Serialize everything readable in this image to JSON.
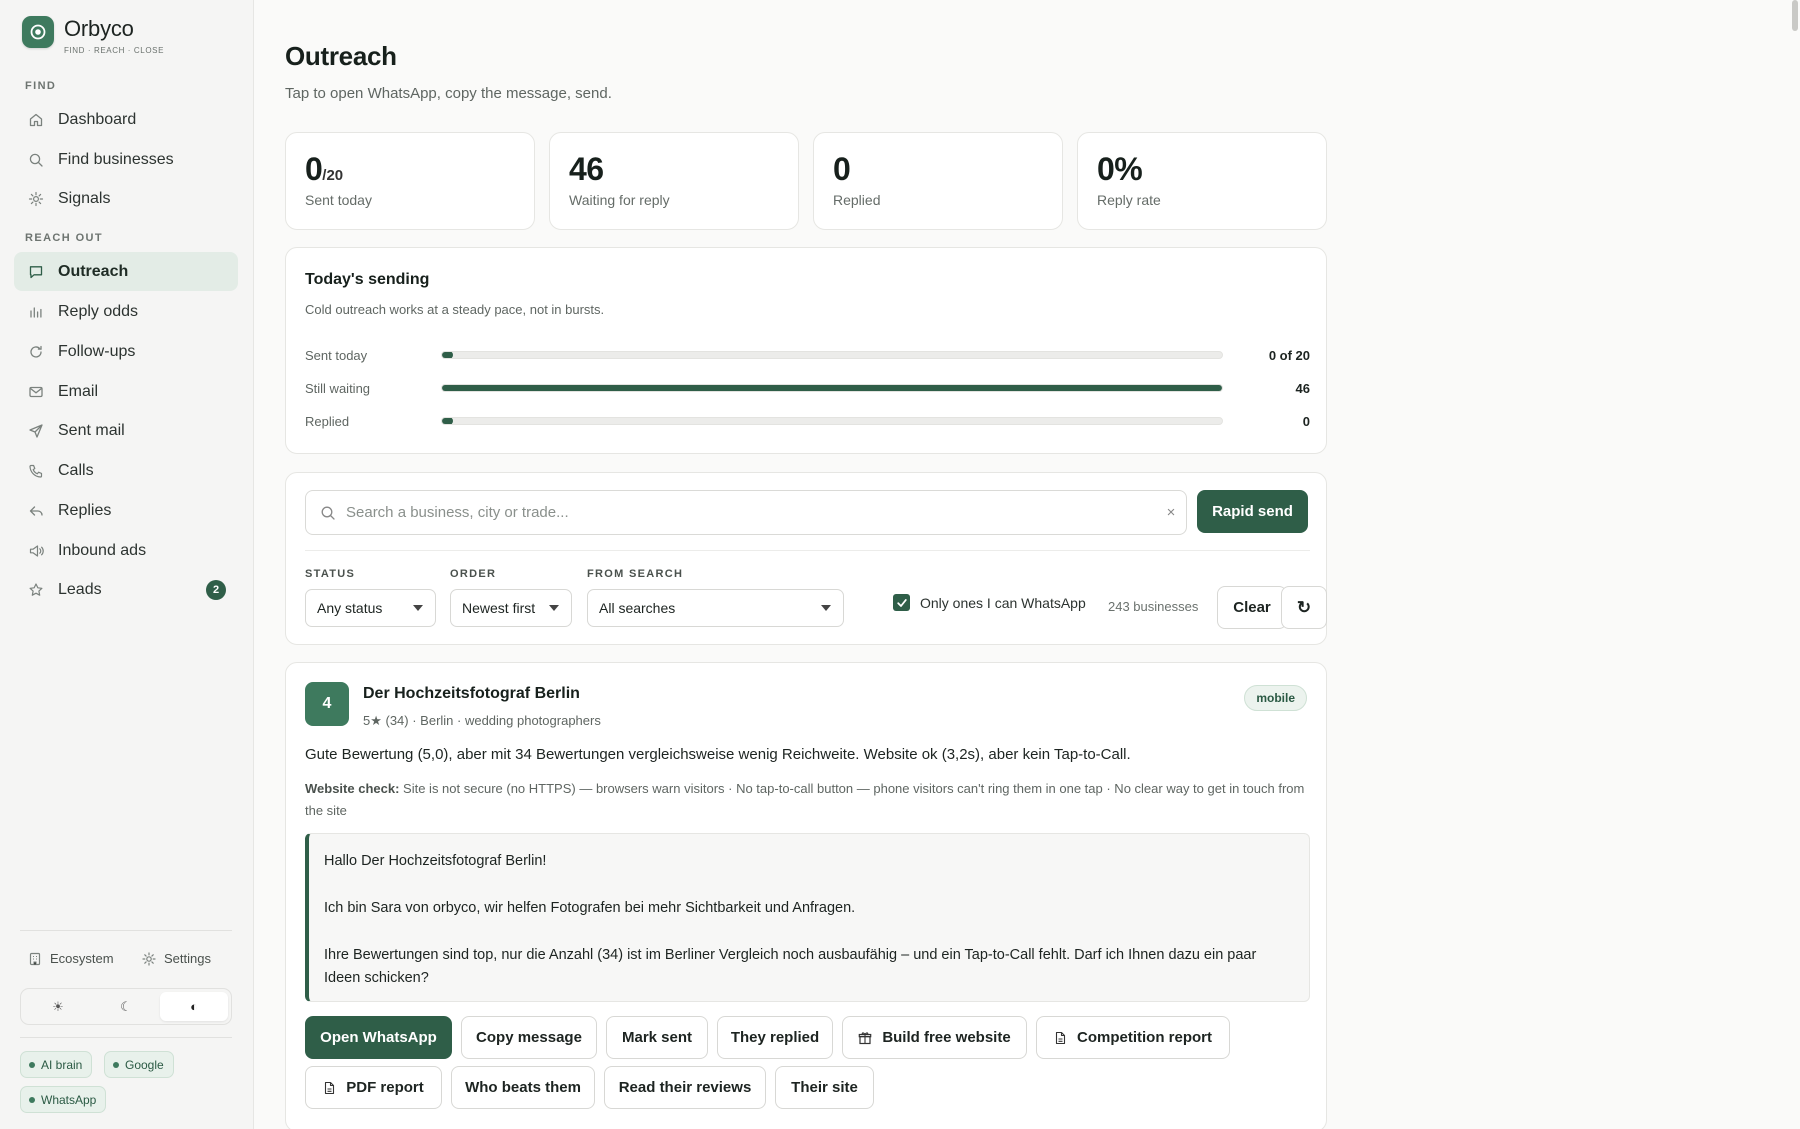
{
  "brand": {
    "name": "Orbyco",
    "tagline": "FIND · REACH · CLOSE"
  },
  "sidebar": {
    "sections": [
      {
        "label": "FIND",
        "items": [
          {
            "label": "Dashboard",
            "icon": "home-icon"
          },
          {
            "label": "Find businesses",
            "icon": "search-icon"
          },
          {
            "label": "Signals",
            "icon": "sparkle-icon"
          }
        ]
      },
      {
        "label": "REACH OUT",
        "items": [
          {
            "label": "Outreach",
            "icon": "chat-icon",
            "active": true
          },
          {
            "label": "Reply odds",
            "icon": "bar-chart-icon"
          },
          {
            "label": "Follow-ups",
            "icon": "refresh-icon"
          },
          {
            "label": "Email",
            "icon": "mail-icon"
          },
          {
            "label": "Sent mail",
            "icon": "send-icon"
          },
          {
            "label": "Calls",
            "icon": "phone-icon"
          },
          {
            "label": "Replies",
            "icon": "reply-icon"
          },
          {
            "label": "Inbound ads",
            "icon": "megaphone-icon"
          },
          {
            "label": "Leads",
            "icon": "star-icon",
            "badge": "2"
          }
        ]
      }
    ],
    "footer_links": [
      {
        "label": "Ecosystem",
        "icon": "building-icon"
      },
      {
        "label": "Settings",
        "icon": "gear-icon"
      }
    ],
    "theme_options": [
      {
        "icon": "sun-icon",
        "glyph": "☀"
      },
      {
        "icon": "moon-icon",
        "glyph": "☾"
      },
      {
        "icon": "contrast-icon",
        "glyph": "◐",
        "active": true
      }
    ],
    "status_chips": [
      "AI brain",
      "Google",
      "WhatsApp"
    ]
  },
  "page": {
    "title": "Outreach",
    "subtitle": "Tap to open WhatsApp, copy the message, send."
  },
  "stats": [
    {
      "value": "0",
      "suffix": "/20",
      "label": "Sent today"
    },
    {
      "value": "46",
      "suffix": "",
      "label": "Waiting for reply"
    },
    {
      "value": "0",
      "suffix": "",
      "label": "Replied"
    },
    {
      "value": "0%",
      "suffix": "",
      "label": "Reply rate"
    }
  ],
  "sending": {
    "title": "Today's sending",
    "description": "Cold outreach works at a steady pace, not in bursts.",
    "rows": [
      {
        "label": "Sent today",
        "value_text": "0 of 20",
        "fraction": 0
      },
      {
        "label": "Still waiting",
        "value_text": "46",
        "fraction": 1
      },
      {
        "label": "Replied",
        "value_text": "0",
        "fraction": 0
      }
    ]
  },
  "filters": {
    "search_placeholder": "Search a business, city or trade...",
    "search_value": "",
    "clear_glyph": "×",
    "rapid_send_label": "Rapid send",
    "status": {
      "label": "STATUS",
      "value": "Any status"
    },
    "order": {
      "label": "ORDER",
      "value": "Newest first"
    },
    "from_search": {
      "label": "FROM SEARCH",
      "value": "All searches"
    },
    "whatsapp_only_label": "Only ones I can WhatsApp",
    "whatsapp_only_checked": true,
    "count_text": "243 businesses",
    "clear_label": "Clear",
    "refresh_glyph": "↻"
  },
  "business": {
    "rank": "4",
    "name": "Der Hochzeitsfotograf Berlin",
    "meta": "5★ (34) · Berlin · wedding photographers",
    "tag": "mobile",
    "summary": "Gute Bewertung (5,0), aber mit 34 Bewertungen vergleichsweise wenig Reichweite. Website ok (3,2s), aber kein Tap-to-Call.",
    "check_label": "Website check:",
    "check_text": "Site is not secure (no HTTPS) — browsers warn visitors · No tap-to-call button — phone visitors can't ring them in one tap · No clear way to get in touch from the site",
    "message": [
      "Hallo Der Hochzeitsfotograf Berlin!",
      "Ich bin Sara von orbyco, wir helfen Fotografen bei mehr Sichtbarkeit und Anfragen.",
      "Ihre Bewertungen sind top, nur die Anzahl (34) ist im Berliner Vergleich noch ausbaufähig – und ein Tap-to-Call fehlt. Darf ich Ihnen dazu ein paar Ideen schicken?"
    ],
    "actions": [
      "Open WhatsApp",
      "Copy message",
      "Mark sent",
      "They replied",
      "Build free website",
      "Competition report",
      "PDF report",
      "Who beats them",
      "Read their reviews",
      "Their site"
    ]
  },
  "colors": {
    "accent": "#2f5e48",
    "brand": "#3e7a5e",
    "active_nav_bg": "#e3ece6"
  }
}
